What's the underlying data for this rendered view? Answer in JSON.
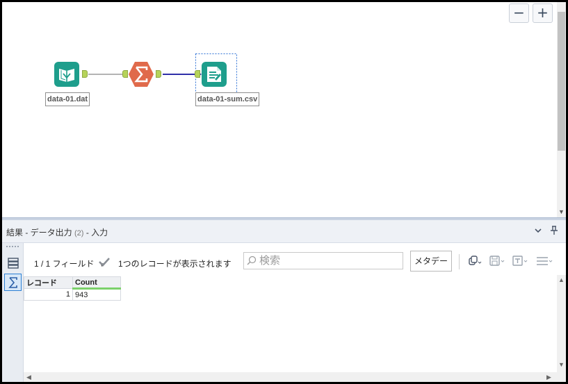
{
  "canvas": {
    "zoom_out": "−",
    "zoom_in": "+",
    "tools": [
      {
        "label": "data-01.dat",
        "icon": "input-data-book-icon"
      },
      {
        "label": "",
        "icon": "summarize-sigma-icon"
      },
      {
        "label": "data-01-sum.csv",
        "icon": "output-data-icon"
      }
    ],
    "colors": {
      "input": "#1e9e8c",
      "summarize": "#e06a4b",
      "output": "#1e9e8c",
      "connector": "#b6d35a",
      "link_selected": "#2f2fa8"
    }
  },
  "results": {
    "title": "結果 - データ出力",
    "title_sub": "(2)",
    "title_suffix": "- 入力",
    "fields": "1 / 1 フィールド",
    "records_shown": "1つのレコードが表示されます",
    "search_placeholder": "検索",
    "metadata_button": "メタデータ",
    "table": {
      "columns": [
        "レコード",
        "Count"
      ],
      "rows": [
        {
          "record": "1",
          "count": "943"
        }
      ]
    }
  }
}
